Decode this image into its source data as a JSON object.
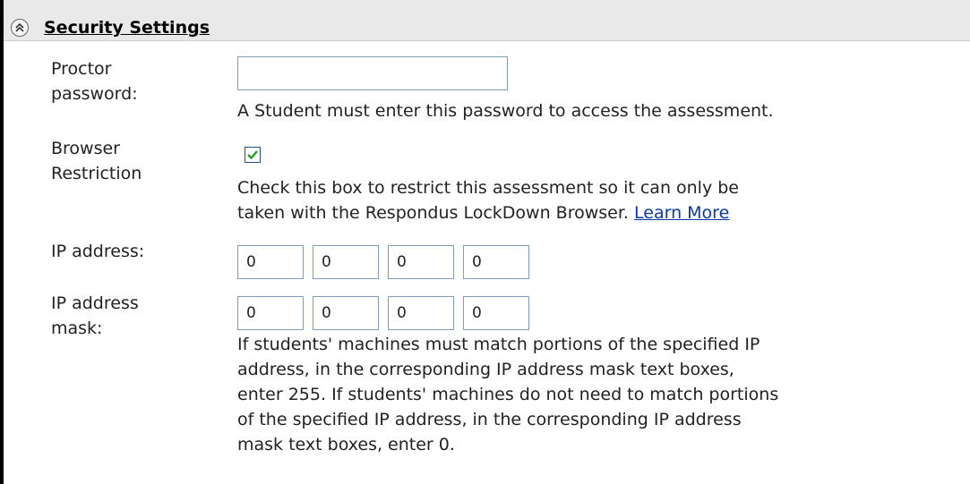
{
  "section": {
    "title": "Security Settings"
  },
  "proctor": {
    "label_line1": "Proctor",
    "label_line2": "password:",
    "value": "",
    "help": "A Student must enter this password to access the assessment."
  },
  "browser_restriction": {
    "label_line1": "Browser",
    "label_line2": "Restriction",
    "checked": true,
    "help_line1": "Check this box to restrict this assessment so it can only be",
    "help_line2_prefix": "taken with the Respondus LockDown Browser.",
    "learn_more": "Learn More"
  },
  "ip_address": {
    "label": "IP address:",
    "octets": [
      "0",
      "0",
      "0",
      "0"
    ]
  },
  "ip_mask": {
    "label_line1": "IP address",
    "label_line2": "mask:",
    "octets": [
      "0",
      "0",
      "0",
      "0"
    ],
    "help_lines": [
      "If students' machines must match portions of the specified IP",
      "address, in the corresponding IP address mask text boxes,",
      "enter 255. If students' machines do not need to match portions",
      "of the specified IP address, in the corresponding IP address",
      "mask text boxes, enter 0."
    ]
  },
  "colors": {
    "header_bg": "#e9e9e9",
    "link": "#0a3aa8",
    "input_border": "#7f9db9",
    "checkmark": "#21a121"
  }
}
